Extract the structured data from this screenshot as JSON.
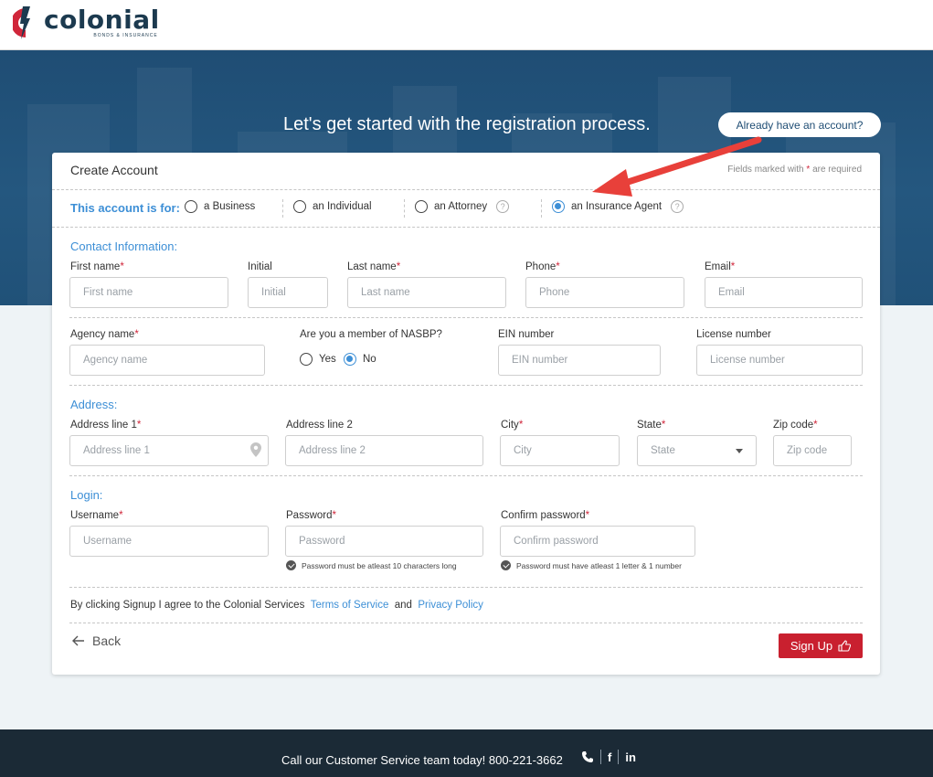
{
  "brand": {
    "name": "colonial",
    "tagline": "BONDS & INSURANCE"
  },
  "hero": {
    "title": "Let's get started with the registration process.",
    "already_btn": "Already have an account?"
  },
  "card": {
    "title": "Create Account",
    "required_note_pre": "Fields marked with",
    "required_star": "*",
    "required_note_post": "are required"
  },
  "account_for": {
    "label": "This account is for:",
    "options": [
      {
        "label": "a Business",
        "checked": false
      },
      {
        "label": "an Individual",
        "checked": false
      },
      {
        "label": "an Attorney",
        "checked": false
      },
      {
        "label": "an Insurance Agent",
        "checked": true
      }
    ]
  },
  "contact": {
    "title": "Contact Information:",
    "first_name": {
      "label": "First name",
      "placeholder": "First name"
    },
    "initial": {
      "label": "Initial",
      "placeholder": "Initial"
    },
    "last_name": {
      "label": "Last name",
      "placeholder": "Last name"
    },
    "phone": {
      "label": "Phone",
      "placeholder": "Phone"
    },
    "email": {
      "label": "Email",
      "placeholder": "Email"
    },
    "agency_name": {
      "label": "Agency name",
      "placeholder": "Agency name"
    },
    "nasbp": {
      "label": "Are you a member of NASBP?",
      "yes": "Yes",
      "no": "No",
      "selected": "No"
    },
    "ein": {
      "label": "EIN number",
      "placeholder": "EIN number"
    },
    "license": {
      "label": "License number",
      "placeholder": "License number"
    }
  },
  "address": {
    "title": "Address:",
    "line1": {
      "label": "Address line 1",
      "placeholder": "Address line 1"
    },
    "line2": {
      "label": "Address line 2",
      "placeholder": "Address line 2"
    },
    "city": {
      "label": "City",
      "placeholder": "City"
    },
    "state": {
      "label": "State",
      "value": "State"
    },
    "zip": {
      "label": "Zip code",
      "placeholder": "Zip code"
    }
  },
  "login": {
    "title": "Login:",
    "username": {
      "label": "Username",
      "placeholder": "Username"
    },
    "password": {
      "label": "Password",
      "placeholder": "Password",
      "hint": "Password must be atleast 10 characters long"
    },
    "confirm": {
      "label": "Confirm password",
      "placeholder": "Confirm password",
      "hint": "Password must have atleast 1 letter & 1 number"
    }
  },
  "agreement": {
    "text": "By clicking Signup I agree to the Colonial Services",
    "terms": "Terms of Service",
    "and": "and",
    "privacy": "Privacy Policy"
  },
  "actions": {
    "back": "Back",
    "signup": "Sign Up"
  },
  "footer": {
    "text": "Call our Customer Service team today! 800-221-3662",
    "facebook": "f",
    "linkedin": "in"
  },
  "colors": {
    "accent_blue": "#3d8fd6",
    "brand_red": "#c9202f",
    "hero_blue": "#1f4d74",
    "footer_bg": "#1b2a36",
    "annotation_arrow": "#e8403a"
  }
}
